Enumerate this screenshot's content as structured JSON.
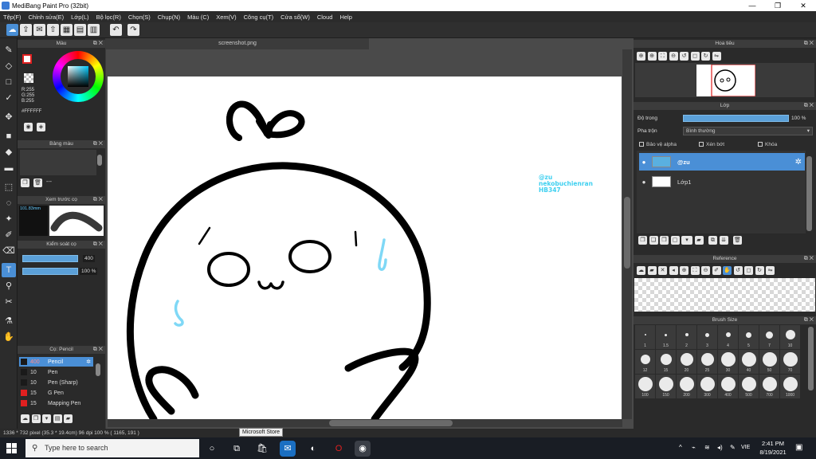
{
  "window": {
    "title": "MediBang Paint Pro (32bit)",
    "minimize": "—",
    "maximize": "❐",
    "close": "✕"
  },
  "menu": [
    "Tệp(F)",
    "Chỉnh sửa(E)",
    "Lớp(L)",
    "Bộ lọc(R)",
    "Chọn(S)",
    "Chụp(N)",
    "Màu (C)",
    "Xem(V)",
    "Công cụ(T)",
    "Cửa sổ(W)",
    "Cloud",
    "Help"
  ],
  "panels": {
    "color": {
      "title": "Màu",
      "r": "R:255",
      "g": "G:255",
      "b": "B:255",
      "hex": "#FFFFFF"
    },
    "palette": {
      "title": "Bảng màu",
      "entry": "---"
    },
    "preview": {
      "title": "Xem trước cọ",
      "size": "101.83mm"
    },
    "control": {
      "title": "Kiểm soát cọ",
      "size_value": "400",
      "opacity_value": "100 %"
    },
    "brush": {
      "title": "Cọ: Pencil",
      "items": [
        {
          "size": "400",
          "name": "Pencil",
          "color": "#1a1a1a"
        },
        {
          "size": "10",
          "name": "Pen",
          "color": "#1a1a1a"
        },
        {
          "size": "10",
          "name": "Pen (Sharp)",
          "color": "#1a1a1a"
        },
        {
          "size": "15",
          "name": "G Pen",
          "color": "#e02020"
        },
        {
          "size": "15",
          "name": "Mapping Pen",
          "color": "#e02020"
        }
      ]
    },
    "navigator": {
      "title": "Hoa tiêu"
    },
    "layer": {
      "title": "Lớp",
      "opacity_label": "Độ trong",
      "opacity_value": "100 %",
      "opacity_fraction": 1.0,
      "blend_label": "Pha trộn",
      "blend_value": "Bình thường",
      "protect_alpha": "Bảo vệ alpha",
      "clipping": "Xén bớt",
      "lock": "Khóa",
      "layers": [
        {
          "name": "@zu",
          "selected": true
        },
        {
          "name": "Lớp1",
          "selected": false
        }
      ]
    },
    "reference": {
      "title": "Reference"
    },
    "brush_size": {
      "title": "Brush Size",
      "sizes": [
        "1",
        "1.5",
        "2",
        "3",
        "4",
        "5",
        "7",
        "10",
        "12",
        "15",
        "20",
        "25",
        "30",
        "40",
        "50",
        "70",
        "100",
        "150",
        "200",
        "300",
        "400",
        "500",
        "700",
        "1000"
      ]
    }
  },
  "document": {
    "tab": "screenshot.png"
  },
  "canvas_text": {
    "line1": "@zu",
    "line2": "nekobuchienran",
    "line3": "HB347",
    "color": "#3fd0f0"
  },
  "status": {
    "text": "1336 * 732 pixel   (35.3 * 19.4cm)   96 dpi   100 %   ( 1165, 191 )"
  },
  "tooltip": "Microsoft Store",
  "taskbar": {
    "search_placeholder": "Type here to search",
    "time": "2:41 PM",
    "date": "8/19/2021",
    "lang": "VIE"
  },
  "colors": {
    "accent": "#4a8fd6",
    "panel": "#2a2a2a"
  }
}
